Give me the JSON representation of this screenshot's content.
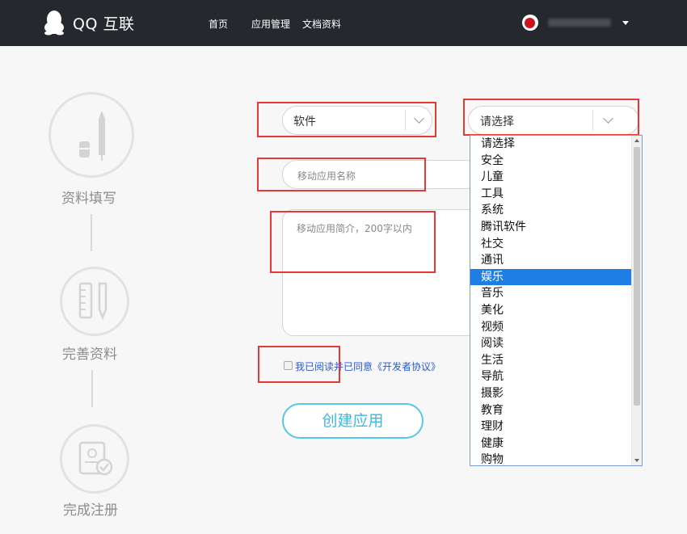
{
  "header": {
    "brand": "QQ 互联",
    "nav": [
      "首页",
      "应用管理",
      "文档资料"
    ]
  },
  "steps": [
    {
      "label": "资料填写",
      "icon": "pen-icon"
    },
    {
      "label": "完善资料",
      "icon": "ruler-pen-icon"
    },
    {
      "label": "完成注册",
      "icon": "certificate-check-icon"
    }
  ],
  "form": {
    "platform_select": {
      "value": "软件"
    },
    "category_select": {
      "value": "请选择"
    },
    "name_input": {
      "placeholder": "移动应用名称"
    },
    "description_input": {
      "placeholder": "移动应用简介，200字以内"
    },
    "agreement_label": "我已阅读并已同意《开发者协议》",
    "create_button": "创建应用"
  },
  "dropdown": {
    "options": [
      "请选择",
      "安全",
      "儿童",
      "工具",
      "系统",
      "腾讯软件",
      "社交",
      "通讯",
      "娱乐",
      "音乐",
      "美化",
      "视频",
      "阅读",
      "生活",
      "导航",
      "摄影",
      "教育",
      "理财",
      "健康",
      "购物"
    ],
    "highlighted": "娱乐"
  },
  "colors": {
    "topbar": "#25282d",
    "highlight": "#1e7ee6",
    "annotation_red": "#e53935",
    "button_accent": "#57c7e8",
    "link": "#2a5ad7"
  }
}
